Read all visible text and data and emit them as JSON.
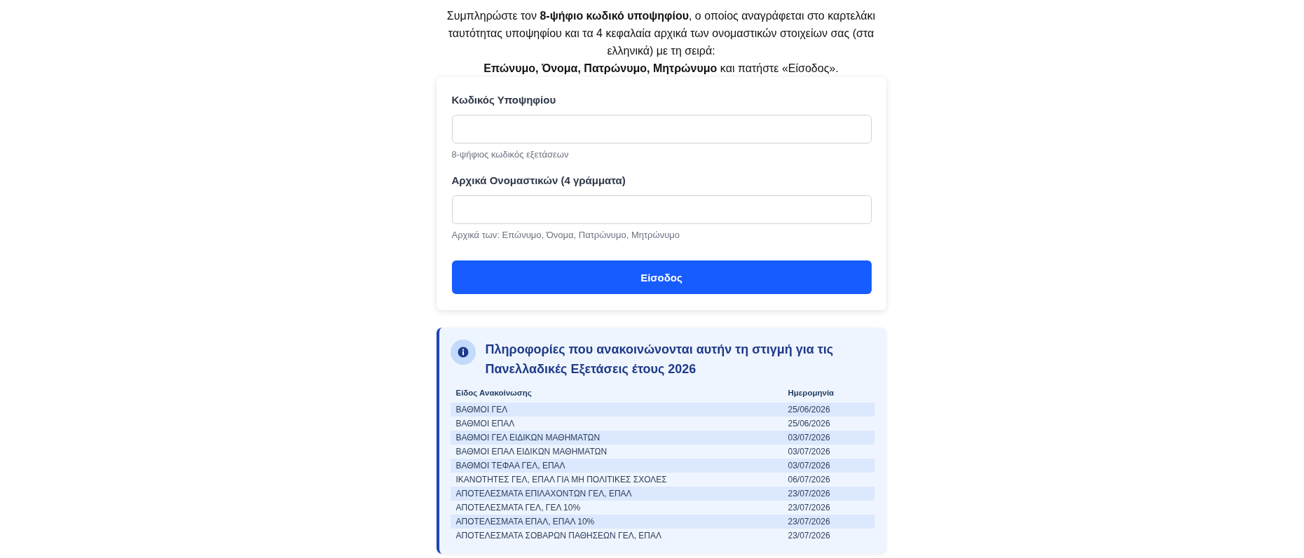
{
  "intro": {
    "text": "Συμπληρώστε τον **8-ψήφιο κωδικό υποψηφίου**, ο οποίος αναγράφεται στο καρτελάκι ταυτότητας υποψηφίου και τα 4 κεφαλαία αρχικά των ονομαστικών στοιχείων σας (στα ελληνικά) με τη σειρά:",
    "order_text": "**Επώνυμο, Όνομα, Πατρώνυμο, Μητρώνυμο** και πατήστε «Είσοδος»."
  },
  "form": {
    "fields": [
      {
        "label": "Κωδικός Υποψηφίου",
        "hint": "8-ψήφιος κωδικός εξετάσεων"
      },
      {
        "label": "Αρχικά Ονομαστικών (4 γράμματα)",
        "hint": "Αρχικά των: Επώνυμο, Όνομα, Πατρώνυμο, Μητρώνυμο"
      }
    ],
    "submit": "Είσοδος"
  },
  "announcements": {
    "title": "Πληροφορίες που ανακοινώνονται αυτήν τη στιγμή για τις Πανελλαδικές Εξετάσεις έτους 2026",
    "columns": [
      "Είδος Ανακοίνωσης",
      "Ημερομηνία"
    ],
    "rows": [
      {
        "type": "ΒΑΘΜΟΙ ΓΕΛ",
        "date": "25/06/2026"
      },
      {
        "type": "ΒΑΘΜΟΙ ΕΠΑΛ",
        "date": "25/06/2026"
      },
      {
        "type": "ΒΑΘΜΟΙ ΓΕΛ ΕΙΔΙΚΩΝ ΜΑΘΗΜΑΤΩΝ",
        "date": "03/07/2026"
      },
      {
        "type": "ΒΑΘΜΟΙ ΕΠΑΛ ΕΙΔΙΚΩΝ ΜΑΘΗΜΑΤΩΝ",
        "date": "03/07/2026"
      },
      {
        "type": "ΒΑΘΜΟΙ ΤΕΦΑΑ ΓΕΛ, ΕΠΑΛ",
        "date": "03/07/2026"
      },
      {
        "type": "ΙΚΑΝΟΤΗΤΕΣ ΓΕΛ, ΕΠΑΛ ΓΙΑ ΜΗ ΠΟΛΙΤΙΚΕΣ ΣΧΟΛΕΣ",
        "date": "06/07/2026"
      },
      {
        "type": "ΑΠΟΤΕΛΕΣΜΑΤΑ ΕΠΙΛΑΧΟΝΤΩΝ ΓΕΛ, ΕΠΑΛ",
        "date": "23/07/2026"
      },
      {
        "type": "ΑΠΟΤΕΛΕΣΜΑΤΑ ΓΕΛ, ΓΕΛ 10%",
        "date": "23/07/2026"
      },
      {
        "type": "ΑΠΟΤΕΛΕΣΜΑΤΑ ΕΠΑΛ, ΕΠΑΛ 10%",
        "date": "23/07/2026"
      },
      {
        "type": "ΑΠΟΤΕΛΕΣΜΑΤΑ ΣΟΒΑΡΩΝ ΠΑΘΗΣΕΩΝ ΓΕΛ, ΕΠΑΛ",
        "date": "23/07/2026"
      }
    ]
  }
}
